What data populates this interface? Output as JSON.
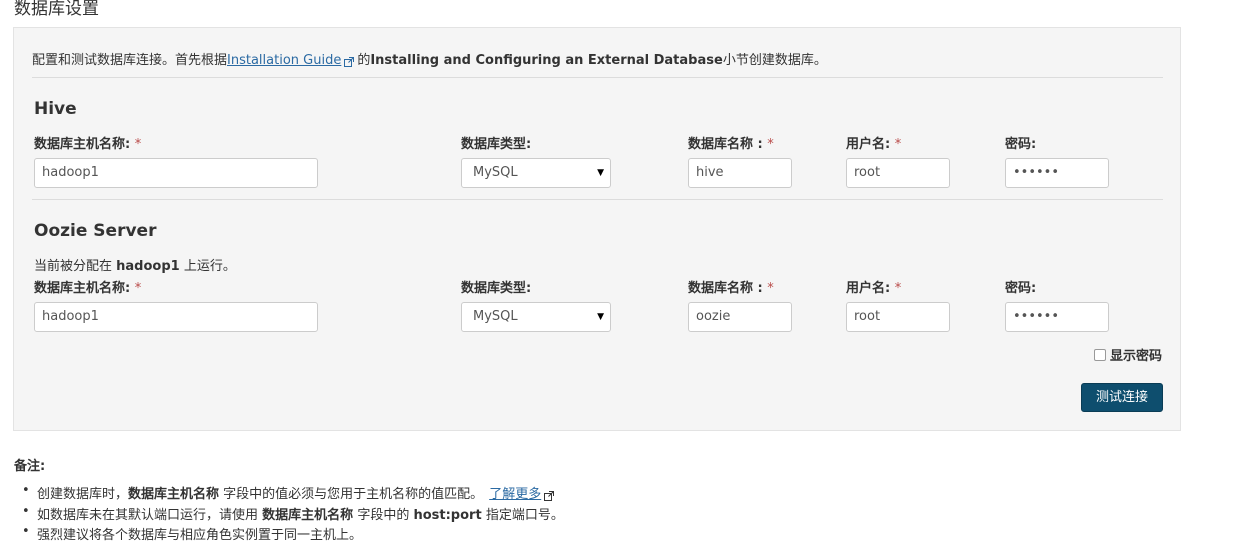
{
  "page_title": "数据库设置",
  "intro": {
    "prefix": "配置和测试数据库连接。首先根据",
    "link": "Installation Guide",
    "mid": "的",
    "bold": "Installing and Configuring an External Database",
    "suffix": "小节创建数据库。"
  },
  "required_mark": "*",
  "hive": {
    "title": "Hive",
    "labels": {
      "host": "数据库主机名称:",
      "db_type": "数据库类型:",
      "db_name": "数据库名称 :",
      "username": "用户名:",
      "password": "密码:"
    },
    "values": {
      "host": "hadoop1",
      "db_type": "MySQL",
      "db_name": "hive",
      "username": "root",
      "password": "••••••"
    }
  },
  "oozie": {
    "title": "Oozie Server",
    "assigned_prefix": "当前被分配在",
    "assigned_host": "hadoop1",
    "assigned_suffix": "上运行。",
    "labels": {
      "host": "数据库主机名称:",
      "db_type": "数据库类型:",
      "db_name": "数据库名称 :",
      "username": "用户名:",
      "password": "密码:"
    },
    "values": {
      "host": "hadoop1",
      "db_type": "MySQL",
      "db_name": "oozie",
      "username": "root",
      "password": "••••••"
    }
  },
  "show_password_label": "显示密码",
  "test_button": "测试连接",
  "notes": {
    "title": "备注:",
    "item1": {
      "prefix": "创建数据库时，",
      "bold": "数据库主机名称",
      "suffix": "字段中的值必须与您用于主机名称的值匹配。",
      "link": "了解更多"
    },
    "item2": {
      "prefix": "如数据库未在其默认端口运行，请使用",
      "bold1": "数据库主机名称",
      "mid": "字段中的",
      "bold2": "host:port",
      "suffix": "指定端口号。"
    },
    "item3": "强烈建议将各个数据库与相应角色实例置于同一主机上。"
  },
  "colors": {
    "button_bg": "#0e4e6e",
    "link": "#2b6aa3",
    "required": "#b94a48",
    "panel_bg": "#f5f5f5"
  }
}
